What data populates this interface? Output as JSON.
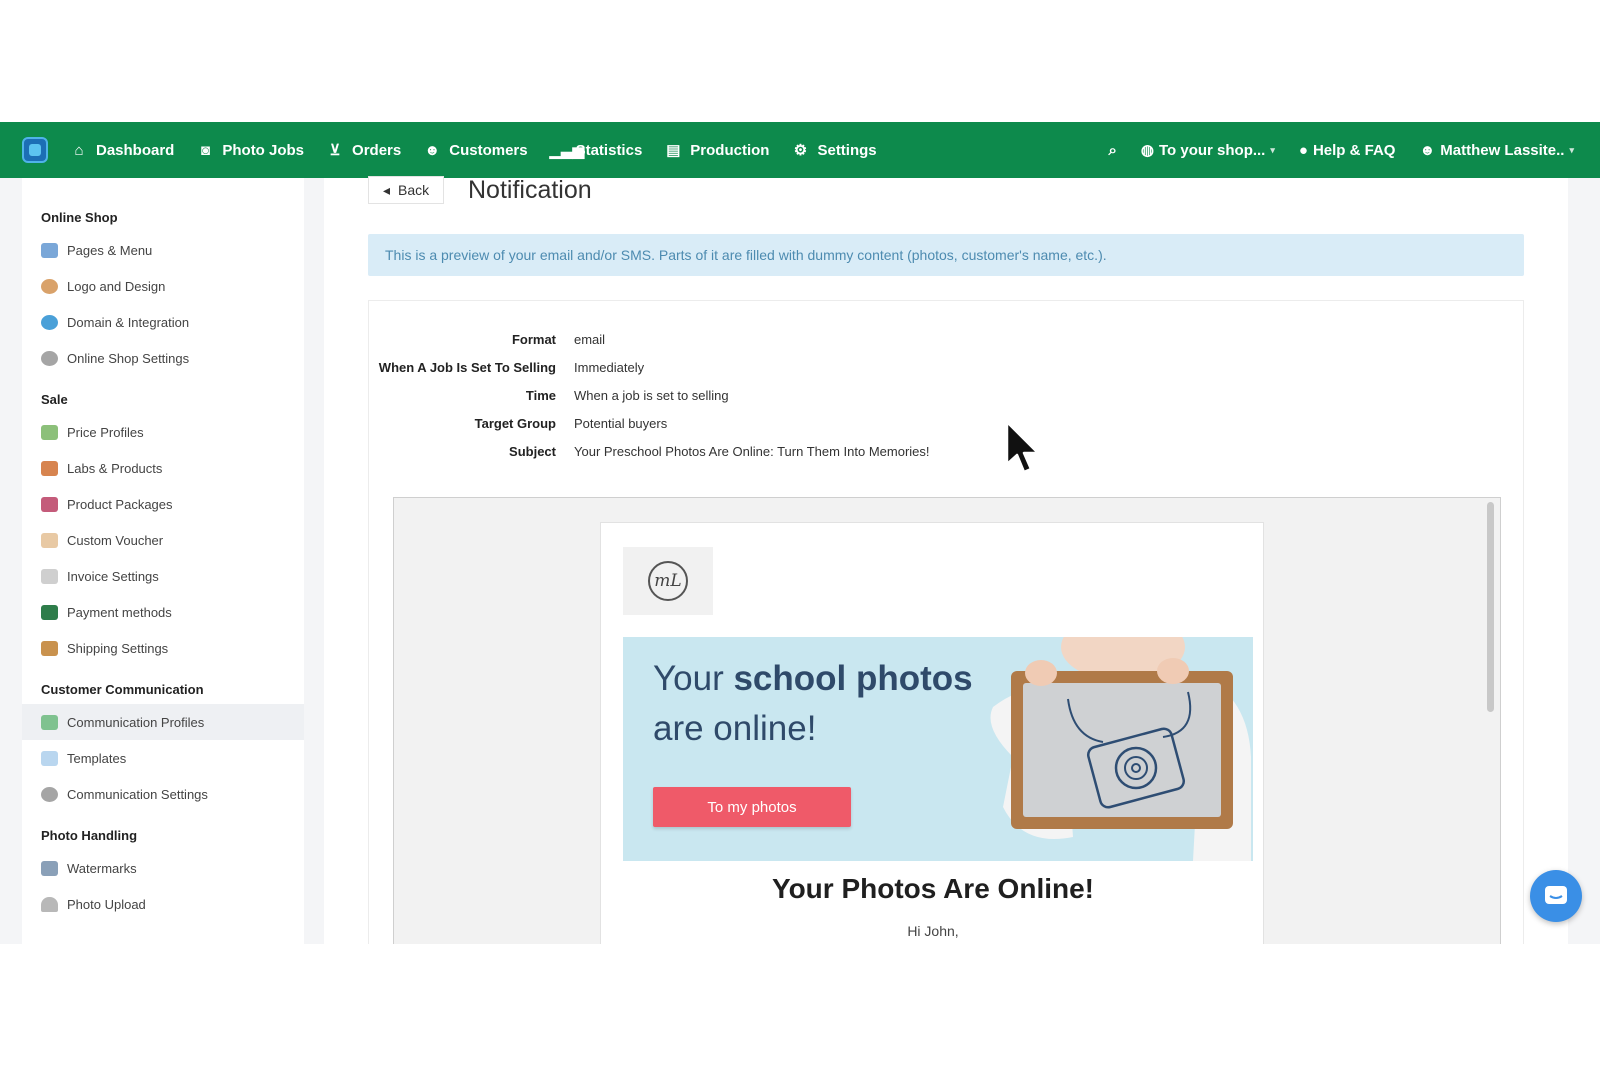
{
  "topnav": {
    "items": [
      {
        "label": "Dashboard",
        "icon": "home-icon"
      },
      {
        "label": "Photo Jobs",
        "icon": "camera-icon"
      },
      {
        "label": "Orders",
        "icon": "cart-icon"
      },
      {
        "label": "Customers",
        "icon": "user-icon"
      },
      {
        "label": "Statistics",
        "icon": "bar-chart-icon"
      },
      {
        "label": "Production",
        "icon": "printer-icon"
      },
      {
        "label": "Settings",
        "icon": "gear-icon"
      }
    ],
    "shop_link": "To your shop...",
    "help": "Help & FAQ",
    "user": "Matthew Lassite..",
    "color": "#0d8a4c"
  },
  "sidebar": {
    "sections": [
      {
        "title": "Online Shop",
        "items": [
          "Pages & Menu",
          "Logo and Design",
          "Domain & Integration",
          "Online Shop Settings"
        ]
      },
      {
        "title": "Sale",
        "items": [
          "Price Profiles",
          "Labs & Products",
          "Product Packages",
          "Custom Voucher",
          "Invoice Settings",
          "Payment methods",
          "Shipping Settings"
        ]
      },
      {
        "title": "Customer Communication",
        "items": [
          "Communication Profiles",
          "Templates",
          "Communication Settings"
        ]
      },
      {
        "title": "Photo Handling",
        "items": [
          "Watermarks",
          "Photo Upload"
        ]
      }
    ],
    "active_item": "Communication Profiles"
  },
  "main": {
    "back_label": "Back",
    "title": "Notification",
    "alert": "This is a preview of your email and/or SMS. Parts of it are filled with dummy content (photos, customer's name, etc.).",
    "details": [
      {
        "label": "Format",
        "value": "email"
      },
      {
        "label": "When A Job Is Set To Selling",
        "value": "Immediately"
      },
      {
        "label": "Time",
        "value": "When a job is set to selling"
      },
      {
        "label": "Target Group",
        "value": "Potential buyers"
      },
      {
        "label": "Subject",
        "value": "Your Preschool Photos Are Online: Turn Them Into Memories!"
      }
    ]
  },
  "email": {
    "logo_text": "mL",
    "banner_line1_pre": "Your ",
    "banner_line1_bold": "school photos",
    "banner_line2": "are online!",
    "button": "To my photos",
    "heading": "Your Photos Are Online!",
    "greeting": "Hi John,",
    "button_color": "#ef5a69"
  }
}
